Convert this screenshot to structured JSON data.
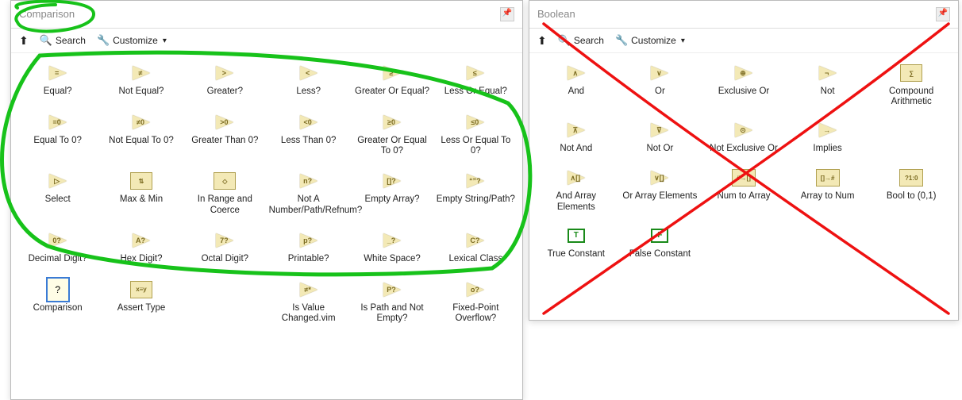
{
  "panels": {
    "comparison": {
      "title": "Comparison",
      "toolbar": {
        "search": "Search",
        "customize": "Customize"
      },
      "rows": [
        [
          {
            "label": "Equal?",
            "sym": "="
          },
          {
            "label": "Not Equal?",
            "sym": "≠"
          },
          {
            "label": "Greater?",
            "sym": ">"
          },
          {
            "label": "Less?",
            "sym": "<"
          },
          {
            "label": "Greater Or Equal?",
            "sym": "≥"
          },
          {
            "label": "Less Or Equal?",
            "sym": "≤"
          }
        ],
        [
          {
            "label": "Equal To 0?",
            "sym": "=0"
          },
          {
            "label": "Not Equal To 0?",
            "sym": "≠0"
          },
          {
            "label": "Greater Than 0?",
            "sym": ">0"
          },
          {
            "label": "Less Than 0?",
            "sym": "<0"
          },
          {
            "label": "Greater Or Equal To 0?",
            "sym": "≥0"
          },
          {
            "label": "Less Or Equal To 0?",
            "sym": "≤0"
          }
        ],
        [
          {
            "label": "Select",
            "sym": "▷",
            "kind": "tri"
          },
          {
            "label": "Max & Min",
            "sym": "⇅",
            "kind": "rbox"
          },
          {
            "label": "In Range and Coerce",
            "sym": "◇",
            "kind": "rbox"
          },
          {
            "label": "Not A Number/Path/Refnum?",
            "sym": "n?"
          },
          {
            "label": "Empty Array?",
            "sym": "[]?"
          },
          {
            "label": "Empty String/Path?",
            "sym": "“”?"
          }
        ],
        [
          {
            "label": "Decimal Digit?",
            "sym": "0?"
          },
          {
            "label": "Hex Digit?",
            "sym": "A?"
          },
          {
            "label": "Octal Digit?",
            "sym": "7?"
          },
          {
            "label": "Printable?",
            "sym": "p?"
          },
          {
            "label": "White Space?",
            "sym": "_?"
          },
          {
            "label": "Lexical Class",
            "sym": "C?"
          }
        ],
        [
          {
            "label": "Comparison",
            "sym": "?",
            "kind": "sel"
          },
          {
            "label": "Assert Type",
            "sym": "x≡y",
            "kind": "rbox"
          },
          {
            "label": "",
            "empty": true
          },
          {
            "label": "Is Value Changed.vim",
            "sym": "≠*"
          },
          {
            "label": "Is Path and Not Empty?",
            "sym": "P?"
          },
          {
            "label": "Fixed-Point Overflow?",
            "sym": "o?"
          }
        ]
      ]
    },
    "boolean": {
      "title": "Boolean",
      "toolbar": {
        "search": "Search",
        "customize": "Customize"
      },
      "rows": [
        [
          {
            "label": "And",
            "sym": "∧"
          },
          {
            "label": "Or",
            "sym": "∨"
          },
          {
            "label": "Exclusive Or",
            "sym": "⊕"
          },
          {
            "label": "Not",
            "sym": "¬"
          },
          {
            "label": "Compound Arithmetic",
            "sym": "∑",
            "kind": "rbox"
          }
        ],
        [
          {
            "label": "Not And",
            "sym": "⊼"
          },
          {
            "label": "Not Or",
            "sym": "⊽"
          },
          {
            "label": "Not Exclusive Or",
            "sym": "⊙"
          },
          {
            "label": "Implies",
            "sym": "→"
          },
          {
            "label": "",
            "empty": true
          }
        ],
        [
          {
            "label": "And Array Elements",
            "sym": "∧[]"
          },
          {
            "label": "Or Array Elements",
            "sym": "∨[]"
          },
          {
            "label": "Num to Array",
            "sym": "#→[]",
            "kind": "rboxw"
          },
          {
            "label": "Array to Num",
            "sym": "[]→#",
            "kind": "rboxw"
          },
          {
            "label": "Bool to (0,1)",
            "sym": "?1:0",
            "kind": "rboxw"
          }
        ],
        [
          {
            "label": "True Constant",
            "sym": "T",
            "kind": "tfc"
          },
          {
            "label": "False Constant",
            "sym": "F",
            "kind": "tfc"
          },
          {
            "label": "",
            "empty": true
          },
          {
            "label": "",
            "empty": true
          },
          {
            "label": "",
            "empty": true
          }
        ]
      ]
    }
  },
  "annotations": {
    "green_circle_title": true,
    "green_circle_rows_1_to_3": true,
    "red_x_over_boolean": true
  }
}
